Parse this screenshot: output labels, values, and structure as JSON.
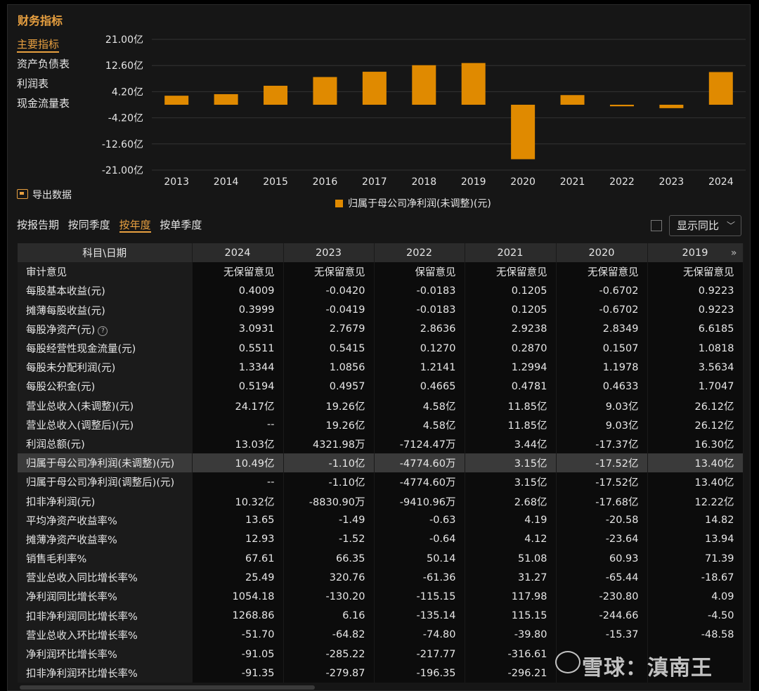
{
  "title": "财务指标",
  "sidenav": [
    "主要指标",
    "资产负债表",
    "利润表",
    "现金流量表"
  ],
  "export_label": "导出数据",
  "chart_data": {
    "type": "bar",
    "categories": [
      "2013",
      "2014",
      "2015",
      "2016",
      "2017",
      "2018",
      "2019",
      "2020",
      "2021",
      "2022",
      "2023",
      "2024"
    ],
    "values": [
      2.9,
      3.4,
      6.1,
      8.9,
      10.6,
      12.7,
      13.4,
      -17.5,
      3.1,
      -0.5,
      -1.1,
      10.5
    ],
    "ytick_labels": [
      "21.00亿",
      "12.60亿",
      "4.20亿",
      "-4.20亿",
      "-12.60亿",
      "-21.00亿"
    ],
    "ylim": [
      -21,
      21
    ],
    "unit": "亿",
    "series_name": "归属于母公司净利润(未调整)(元)",
    "color": "#e08a00",
    "grid": true,
    "legend": "bottom-center"
  },
  "period_tabs": [
    "按报告期",
    "按同季度",
    "按年度",
    "按单季度"
  ],
  "active_period": "按年度",
  "compare_label": "显示同比",
  "table": {
    "header": [
      "科目\\日期",
      "2024",
      "2023",
      "2022",
      "2021",
      "2020",
      "2019"
    ],
    "rows": [
      [
        "审计意见",
        "无保留意见",
        "无保留意见",
        "保留意见",
        "无保留意见",
        "无保留意见",
        "无保留意见"
      ],
      [
        "每股基本收益(元)",
        "0.4009",
        "-0.0420",
        "-0.0183",
        "0.1205",
        "-0.6702",
        "0.9223"
      ],
      [
        "摊薄每股收益(元)",
        "0.3999",
        "-0.0419",
        "-0.0183",
        "0.1205",
        "-0.6702",
        "0.9223"
      ],
      [
        "每股净资产(元)",
        "3.0931",
        "2.7679",
        "2.8636",
        "2.9238",
        "2.8349",
        "6.6185"
      ],
      [
        "每股经营性现金流量(元)",
        "0.5511",
        "0.5415",
        "0.1270",
        "0.2870",
        "0.1507",
        "1.0818"
      ],
      [
        "每股未分配利润(元)",
        "1.3344",
        "1.0856",
        "1.2141",
        "1.2994",
        "1.1978",
        "3.5634"
      ],
      [
        "每股公积金(元)",
        "0.5194",
        "0.4957",
        "0.4665",
        "0.4781",
        "0.4633",
        "1.7047"
      ],
      [
        "营业总收入(未调整)(元)",
        "24.17亿",
        "19.26亿",
        "4.58亿",
        "11.85亿",
        "9.03亿",
        "26.12亿"
      ],
      [
        "营业总收入(调整后)(元)",
        "--",
        "19.26亿",
        "4.58亿",
        "11.85亿",
        "9.03亿",
        "26.12亿"
      ],
      [
        "利润总额(元)",
        "13.03亿",
        "4321.98万",
        "-7124.47万",
        "3.44亿",
        "-17.37亿",
        "16.30亿"
      ],
      [
        "归属于母公司净利润(未调整)(元)",
        "10.49亿",
        "-1.10亿",
        "-4774.60万",
        "3.15亿",
        "-17.52亿",
        "13.40亿"
      ],
      [
        "归属于母公司净利润(调整后)(元)",
        "--",
        "-1.10亿",
        "-4774.60万",
        "3.15亿",
        "-17.52亿",
        "13.40亿"
      ],
      [
        "扣非净利润(元)",
        "10.32亿",
        "-8830.90万",
        "-9410.96万",
        "2.68亿",
        "-17.68亿",
        "12.22亿"
      ],
      [
        "平均净资产收益率%",
        "13.65",
        "-1.49",
        "-0.63",
        "4.19",
        "-20.58",
        "14.82"
      ],
      [
        "摊薄净资产收益率%",
        "12.93",
        "-1.52",
        "-0.64",
        "4.12",
        "-23.64",
        "13.94"
      ],
      [
        "销售毛利率%",
        "67.61",
        "66.35",
        "50.14",
        "51.08",
        "60.93",
        "71.39"
      ],
      [
        "营业总收入同比增长率%",
        "25.49",
        "320.76",
        "-61.36",
        "31.27",
        "-65.44",
        "-18.67"
      ],
      [
        "净利润同比增长率%",
        "1054.18",
        "-130.20",
        "-115.15",
        "117.98",
        "-230.80",
        "4.09"
      ],
      [
        "扣非净利润同比增长率%",
        "1268.86",
        "6.16",
        "-135.14",
        "115.15",
        "-244.66",
        "-4.50"
      ],
      [
        "营业总收入环比增长率%",
        "-51.70",
        "-64.82",
        "-74.80",
        "-39.80",
        "-15.37",
        "-48.58"
      ],
      [
        "净利润环比增长率%",
        "-91.05",
        "-285.22",
        "-217.77",
        "-316.61",
        "",
        ""
      ],
      [
        "扣非净利润环比增长率%",
        "-91.35",
        "-279.87",
        "-196.35",
        "-296.21",
        "",
        ""
      ]
    ],
    "highlight_row": 10
  },
  "watermark": "雪球：滇南王"
}
